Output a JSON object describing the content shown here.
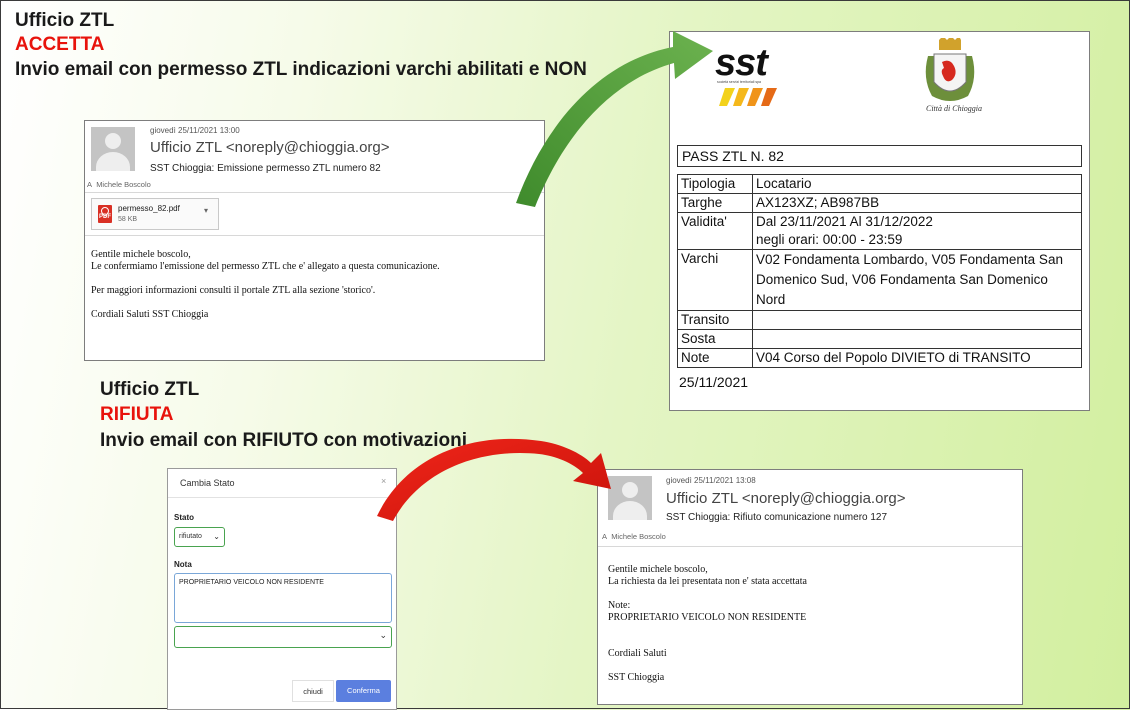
{
  "top_section": {
    "title": "Ufficio ZTL",
    "status": "ACCETTA",
    "description": "Invio email con permesso ZTL indicazioni varchi abilitati e NON"
  },
  "accepted_email": {
    "date": "giovedì 25/11/2021 13:00",
    "from": "Ufficio ZTL <noreply@chioggia.org>",
    "subject": "SST Chioggia: Emissione permesso ZTL numero 82",
    "to_prefix": "A",
    "to": "Michele Boscolo",
    "attachment": {
      "name": "permesso_82.pdf",
      "size": "58 KB",
      "icon": "pdf-icon"
    },
    "body": [
      "Gentile michele boscolo,",
      "Le confermiamo l'emissione del permesso ZTL che e' allegato a questa comunicazione.",
      "Per maggiori informazioni consulti il portale ZTL alla sezione 'storico'.",
      "Cordiali Saluti SST Chioggia"
    ]
  },
  "pass_document": {
    "logo_text": "sst",
    "logo_tagline": "società servizi territoriali spa",
    "city_caption": "Città di Chioggia",
    "title": "PASS ZTL  N. 82",
    "rows": [
      {
        "key": "Tipologia",
        "value": "Locatario"
      },
      {
        "key": "Targhe",
        "value": "AX123XZ; AB987BB"
      },
      {
        "key": "Validita'",
        "value": "Dal 23/11/2021 Al 31/12/2022",
        "value2": "negli orari: 00:00 - 23:59"
      },
      {
        "key": "Varchi",
        "value": "V02 Fondamenta Lombardo, V05 Fondamenta San Domenico Sud, V06 Fondamenta San Domenico Nord"
      },
      {
        "key": "Transito",
        "value": ""
      },
      {
        "key": "Sosta",
        "value": ""
      },
      {
        "key": "Note",
        "value": "V04 Corso del Popolo DIVIETO di TRANSITO"
      }
    ],
    "date": "25/11/2021"
  },
  "bottom_section": {
    "title": "Ufficio ZTL",
    "status": "RIFIUTA",
    "description": "Invio email con RIFIUTO con motivazioni"
  },
  "dialog": {
    "title": "Cambia Stato",
    "close": "×",
    "stato_label": "Stato",
    "stato_value": "rifiutato",
    "nota_label": "Nota",
    "nota_value": "PROPRIETARIO VEICOLO NON RESIDENTE",
    "cancel_label": "chiudi",
    "confirm_label": "Conferma"
  },
  "rejected_email": {
    "date": "giovedì 25/11/2021 13:08",
    "from": "Ufficio ZTL <noreply@chioggia.org>",
    "subject": "SST Chioggia: Rifiuto comunicazione numero 127",
    "to_prefix": "A",
    "to": "Michele Boscolo",
    "body": [
      "Gentile michele boscolo,",
      "La richiesta da lei presentata non e' stata accettata",
      "Note:",
      "PROPRIETARIO VEICOLO NON RESIDENTE",
      "Cordiali Saluti",
      "SST Chioggia"
    ]
  },
  "colors": {
    "heading_red": "#e8130c",
    "arrow_green": "#4f9a38",
    "arrow_red": "#e31b10",
    "button_blue": "#5b7fdf"
  }
}
